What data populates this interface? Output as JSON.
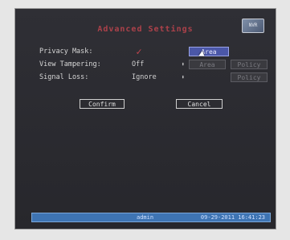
{
  "title": "Advanced Settings",
  "logo_text": "NVR",
  "rows": {
    "privacy": {
      "label": "Privacy Mask:",
      "checked_icon": "checkmark-icon",
      "area_button": "Area"
    },
    "tampering": {
      "label": "View Tampering:",
      "value": "Off",
      "area_button": "Area",
      "policy_button": "Policy"
    },
    "signal": {
      "label": "Signal Loss:",
      "value": "Ignore",
      "policy_button": "Policy"
    }
  },
  "buttons": {
    "confirm": "Confirm",
    "cancel": "Cancel"
  },
  "status": {
    "user": "admin",
    "datetime": "09-29-2011 16:41:23"
  },
  "colors": {
    "accent": "#4b57a8",
    "title": "#c2454e",
    "statusbar": "#3e74b3"
  }
}
